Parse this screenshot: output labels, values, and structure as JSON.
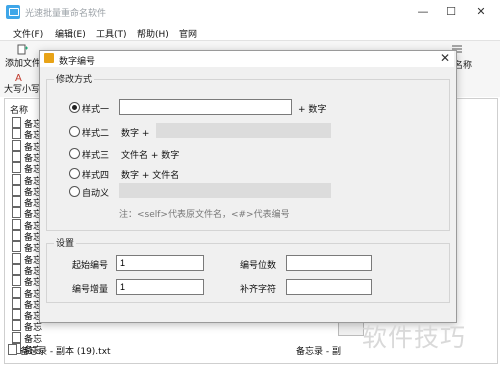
{
  "app": {
    "title": "光速批量重命名软件",
    "window_buttons": {
      "minimize": "—",
      "maximize": "☐",
      "close": "✕"
    }
  },
  "menubar": [
    "文件(F)",
    "编辑(E)",
    "工具(T)",
    "帮助(H)",
    "官网"
  ],
  "toolbar": {
    "add_file": "添加文件",
    "case": "大写小写",
    "right_label": "名称"
  },
  "file_list": {
    "column_header": "名称",
    "row_prefix": "备忘",
    "rows": [
      "备忘",
      "备忘",
      "备忘",
      "备忘",
      "备忘",
      "备忘",
      "备忘",
      "备忘",
      "备忘",
      "备忘",
      "备忘",
      "备忘",
      "备忘",
      "备忘",
      "备忘",
      "备忘",
      "备忘",
      "备忘",
      "备忘",
      "备忘",
      "备忘"
    ],
    "bottom_row_name": "备忘录 - 副本 (19).txt",
    "bottom_row_right": "备忘录 - 副"
  },
  "dialog": {
    "title": "数字编号",
    "close": "✕",
    "method_group": {
      "legend": "修改方式",
      "options": [
        {
          "label": "样式一",
          "checked": true,
          "suffix": "+ 数字"
        },
        {
          "label": "样式二",
          "checked": false,
          "prefix": "数字 +"
        },
        {
          "label": "样式三",
          "checked": false,
          "text": "文件名 + 数字"
        },
        {
          "label": "样式四",
          "checked": false,
          "text": "数字 + 文件名"
        },
        {
          "label": "自动义",
          "checked": false
        }
      ],
      "style1_value": "",
      "note": "注：<self>代表原文件名，<#>代表编号"
    },
    "settings_group": {
      "legend": "设置",
      "start_label": "起始编号",
      "start_value": "1",
      "digits_label": "编号位数",
      "digits_value": "",
      "increment_label": "编号增量",
      "increment_value": "1",
      "pad_label": "补齐字符",
      "pad_value": ""
    }
  },
  "watermark": "软件技巧"
}
